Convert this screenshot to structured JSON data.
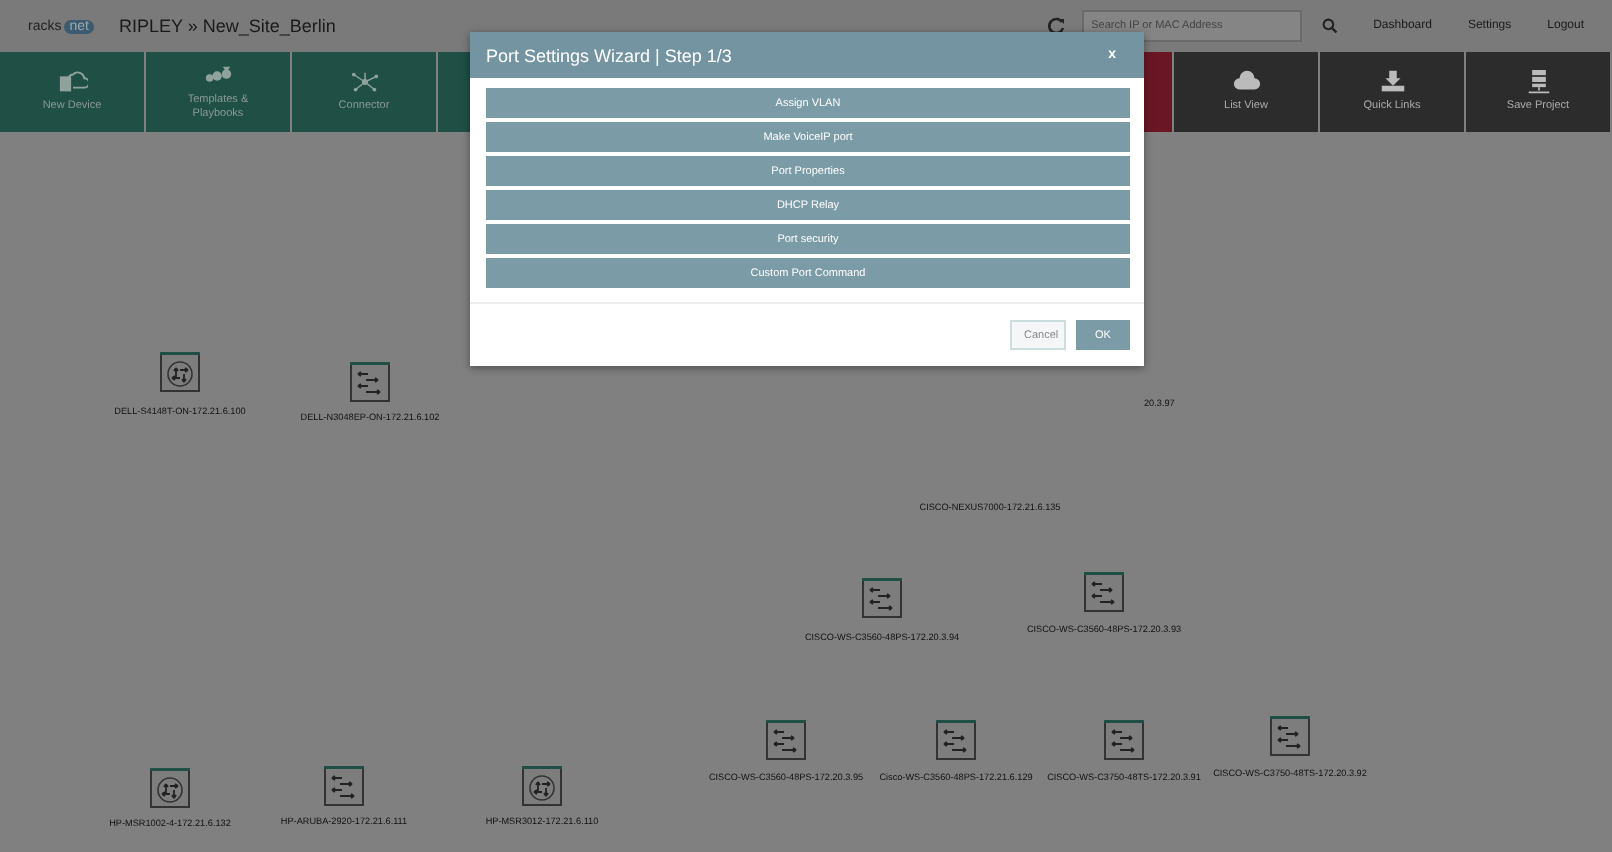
{
  "header": {
    "logo_left": "racks",
    "logo_right": "net",
    "title": "RIPLEY » New_Site_Berlin",
    "search": {
      "placeholder": "Search IP or MAC Address"
    },
    "links": [
      "Dashboard",
      "Settings",
      "Logout"
    ]
  },
  "toolbar": [
    {
      "label": "New Device",
      "kind": "green"
    },
    {
      "label": "Templates &\nPlaybooks",
      "kind": "green"
    },
    {
      "label": "Connector",
      "kind": "green"
    },
    {
      "kind": "red"
    },
    {
      "label": "List View",
      "kind": "dark"
    },
    {
      "label": "Quick Links",
      "kind": "dark"
    },
    {
      "label": "Save Project",
      "kind": "dark"
    }
  ],
  "nodes": [
    {
      "label": "DELL-S4148T-ON-172.21.6.100",
      "kind": "router"
    },
    {
      "label": "DELL-N3048EP-ON-172.21.6.102",
      "kind": "switch"
    },
    {
      "label": "20.3.97",
      "kind": "hidden"
    },
    {
      "label": "CISCO-NEXUS7000-172.21.6.135",
      "kind": "hidden"
    },
    {
      "label": "CISCO-WS-C3560-48PS-172.20.3.94",
      "kind": "switch"
    },
    {
      "label": "CISCO-WS-C3560-48PS-172.20.3.93",
      "kind": "switch"
    },
    {
      "label": "HP-MSR1002-4-172.21.6.132",
      "kind": "router"
    },
    {
      "label": "HP-ARUBA-2920-172.21.6.111",
      "kind": "switch"
    },
    {
      "label": "HP-MSR3012-172.21.6.110",
      "kind": "router"
    },
    {
      "label": "CISCO-WS-C3560-48PS-172.20.3.95",
      "kind": "switch"
    },
    {
      "label": "Cisco-WS-C3560-48PS-172.21.6.129",
      "kind": "switch"
    },
    {
      "label": "CISCO-WS-C3750-48TS-172.20.3.91",
      "kind": "switch"
    },
    {
      "label": "CISCO-WS-C3750-48TS-172.20.3.92",
      "kind": "switch"
    }
  ],
  "dialog": {
    "title": "Port Settings Wizard | Step 1/3",
    "close": "x",
    "options": [
      "Assign VLAN",
      "Make VoiceIP port",
      "Port Properties",
      "DHCP Relay",
      "Port security",
      "Custom Port Command"
    ],
    "cancel": "Cancel",
    "ok": "OK"
  }
}
